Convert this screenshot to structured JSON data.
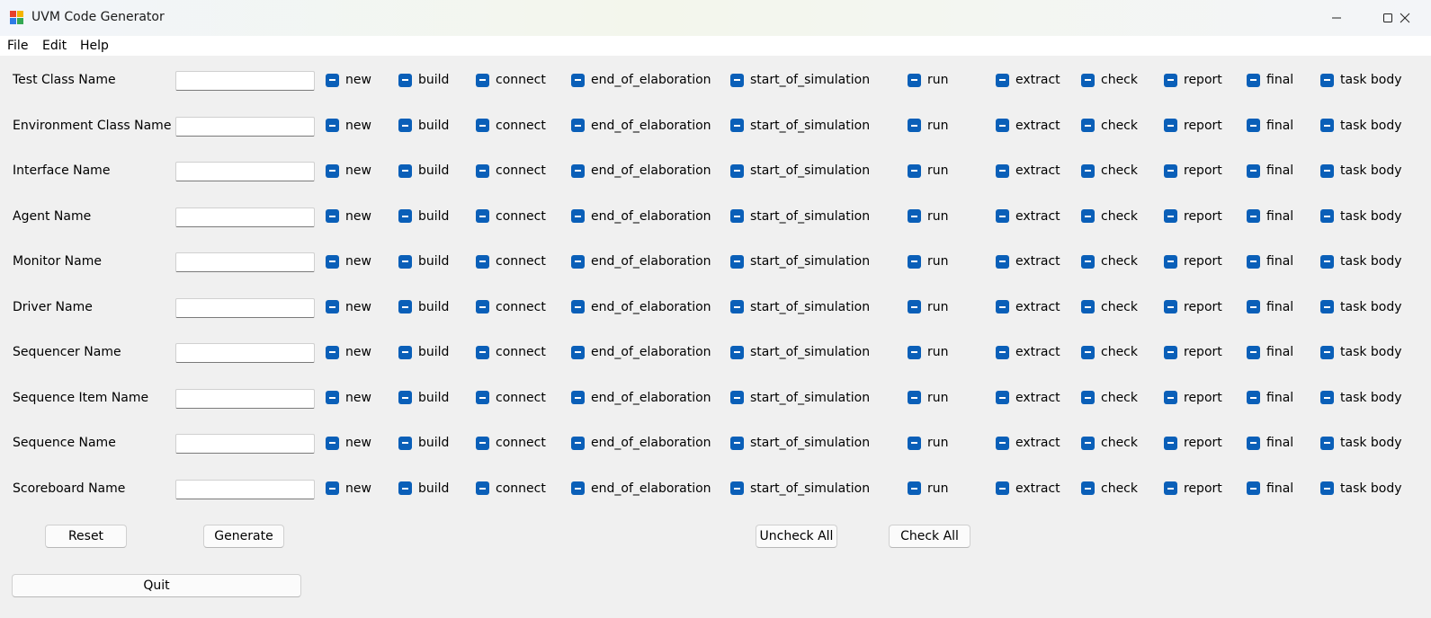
{
  "window": {
    "title": "UVM Code Generator",
    "icon": "app-grid-icon",
    "controls": [
      "minimize-icon",
      "maximize-icon",
      "close-icon"
    ]
  },
  "menu": {
    "items": [
      "File",
      "Edit",
      "Help"
    ]
  },
  "checkbox_labels": [
    "new",
    "build",
    "connect",
    "end_of_elaboration",
    "start_of_simulation",
    "run",
    "extract",
    "check",
    "report",
    "final",
    "task body"
  ],
  "checkbox_state": "indeterminate",
  "rows": [
    {
      "label": "Test Class Name",
      "value": ""
    },
    {
      "label": "Environment Class Name",
      "value": ""
    },
    {
      "label": "Interface Name",
      "value": ""
    },
    {
      "label": "Agent Name",
      "value": ""
    },
    {
      "label": "Monitor Name",
      "value": ""
    },
    {
      "label": "Driver Name",
      "value": ""
    },
    {
      "label": "Sequencer Name",
      "value": ""
    },
    {
      "label": "Sequence Item Name",
      "value": ""
    },
    {
      "label": "Sequence Name",
      "value": ""
    },
    {
      "label": "Scoreboard Name",
      "value": ""
    }
  ],
  "buttons": {
    "reset": "Reset",
    "generate": "Generate",
    "uncheck_all": "Uncheck All",
    "check_all": "Check All",
    "quit": "Quit"
  },
  "colors": {
    "checkbox_fill": "#0a5fb8",
    "window_bg": "#f0f0f0"
  }
}
